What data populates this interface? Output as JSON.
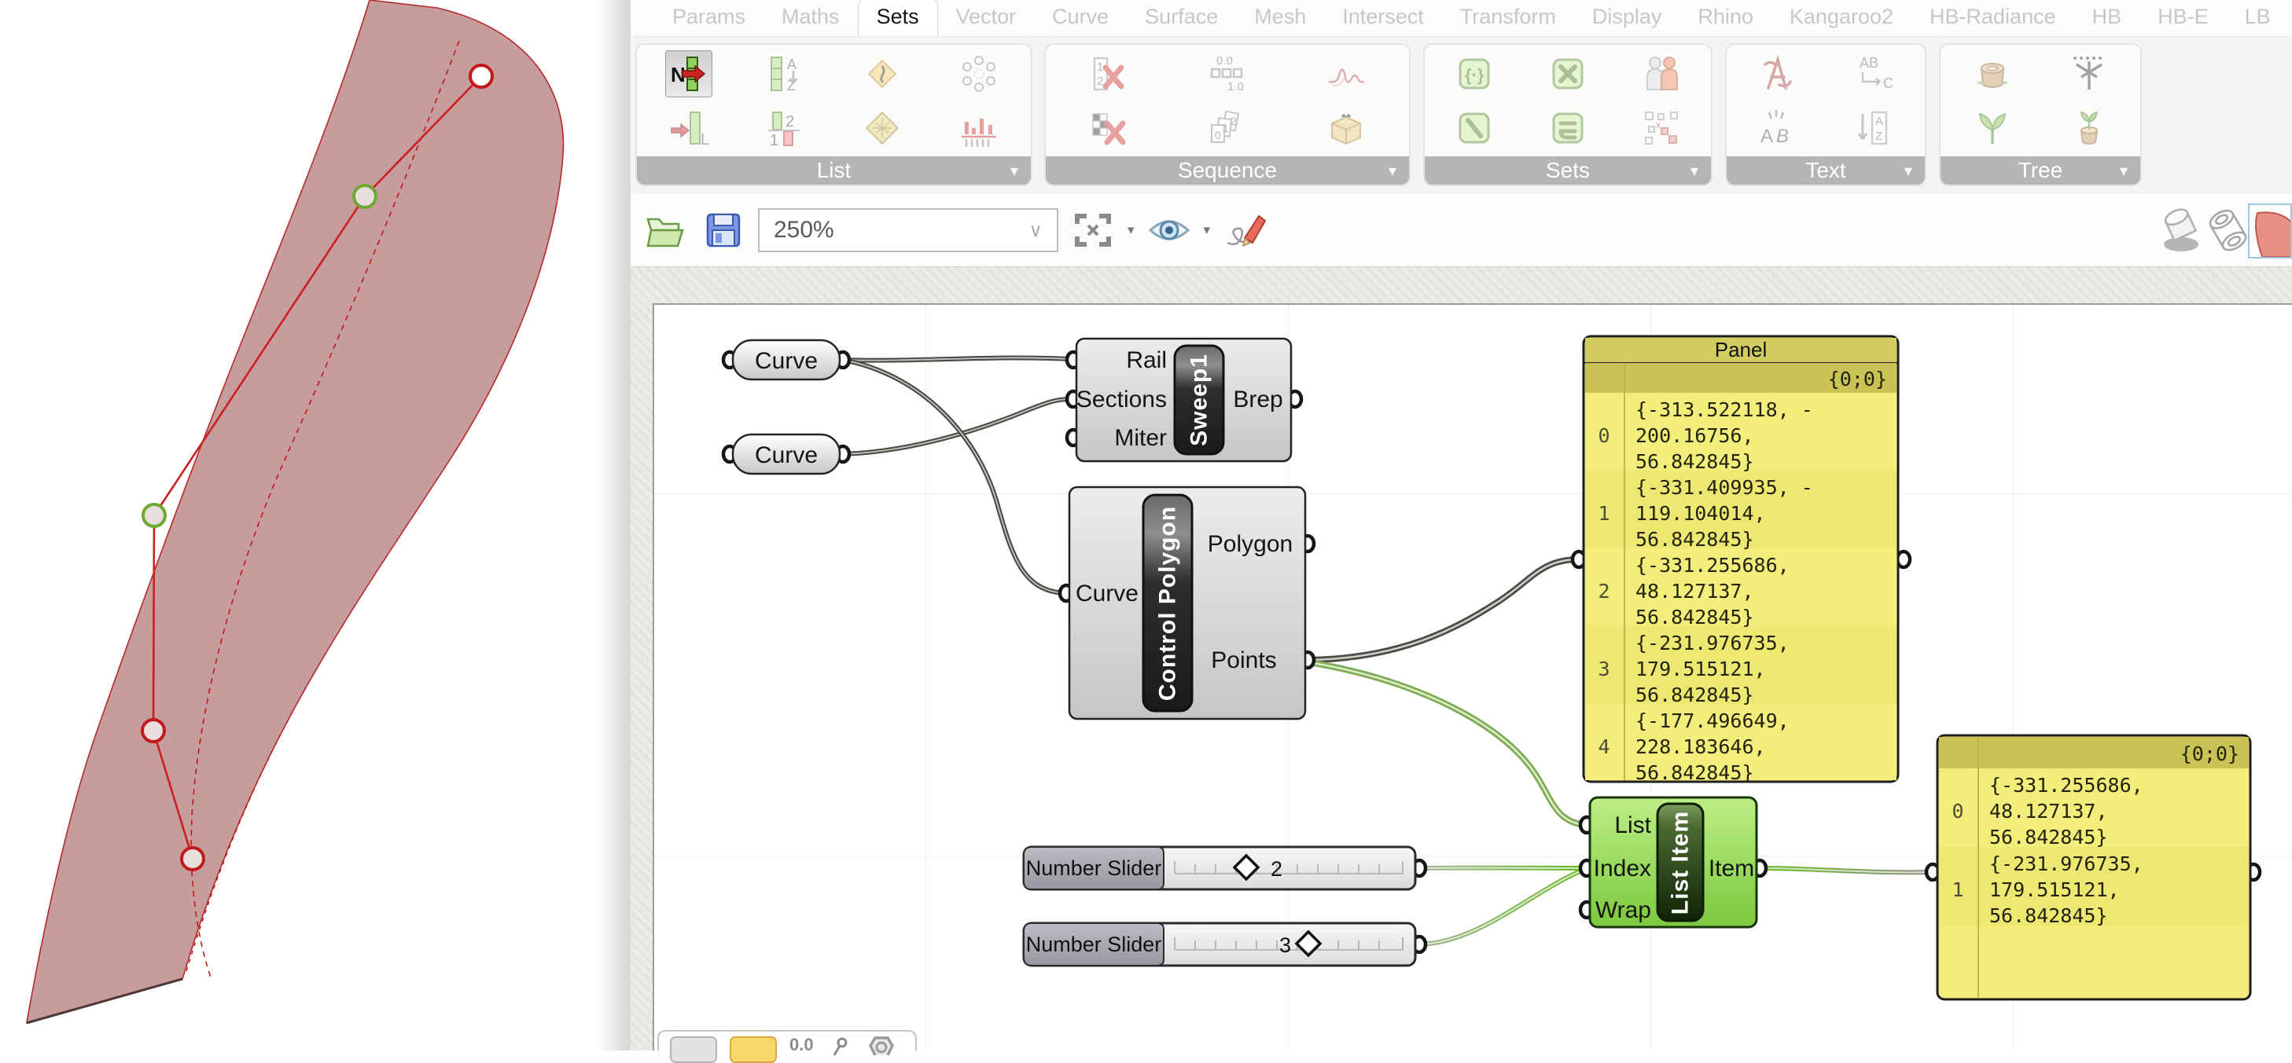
{
  "menu": {
    "tabs": [
      {
        "label": "Params",
        "active": false
      },
      {
        "label": "Maths",
        "active": false
      },
      {
        "label": "Sets",
        "active": true
      },
      {
        "label": "Vector",
        "active": false
      },
      {
        "label": "Curve",
        "active": false
      },
      {
        "label": "Surface",
        "active": false
      },
      {
        "label": "Mesh",
        "active": false
      },
      {
        "label": "Intersect",
        "active": false
      },
      {
        "label": "Transform",
        "active": false
      },
      {
        "label": "Display",
        "active": false
      },
      {
        "label": "Rhino",
        "active": false
      },
      {
        "label": "Kangaroo2",
        "active": false
      },
      {
        "label": "HB-Radiance",
        "active": false
      },
      {
        "label": "HB",
        "active": false
      },
      {
        "label": "HB-E",
        "active": false
      },
      {
        "label": "LB",
        "active": false
      }
    ]
  },
  "ribbon": {
    "groups": [
      {
        "label": "List",
        "icons": [
          "list-item",
          "sort-list",
          "item-index",
          "weave",
          "shift-list",
          "partition-list",
          "sift-pattern",
          "dispatch"
        ]
      },
      {
        "label": "Sequence",
        "icons": [
          "cull-index",
          "range",
          "random",
          "cull-pattern",
          "sequence",
          "cull-box"
        ]
      },
      {
        "label": "Sets",
        "icons": [
          "create-set",
          "set-difference",
          "member-index",
          "set-intersection",
          "set-union",
          "delete-consecutive"
        ]
      },
      {
        "label": "Text",
        "icons": [
          "text-fragment",
          "concatenate",
          "characters",
          "sort-text"
        ]
      },
      {
        "label": "Tree",
        "icons": [
          "tree-stump",
          "explode-tree",
          "flatten-tree",
          "graft-tree"
        ]
      }
    ]
  },
  "canvas_toolbar": {
    "zoom_value": "250%",
    "icons": [
      "open-file",
      "save-file",
      "zoom-extents",
      "preview",
      "sketch",
      "shaded-preview",
      "wireframe-preview",
      "selected-only-preview"
    ]
  },
  "graph": {
    "curve1": {
      "label": "Curve"
    },
    "curve2": {
      "label": "Curve"
    },
    "sweep": {
      "title": "Sweep1",
      "inputs": [
        "Rail",
        "Sections",
        "Miter"
      ],
      "output": "Brep"
    },
    "control_polygon": {
      "title": "Control Polygon",
      "input": "Curve",
      "outputs": [
        "Polygon",
        "Points"
      ]
    },
    "list_item": {
      "title": "List Item",
      "inputs": [
        "List",
        "Index",
        "Wrap"
      ],
      "output": "Item"
    },
    "slider1": {
      "label": "Number Slider",
      "value": "2"
    },
    "slider2": {
      "label": "Number Slider",
      "value": "3"
    },
    "panel_left": {
      "title": "Panel",
      "path": "{0;0}",
      "rows": [
        {
          "index": "0",
          "lines": [
            "{-313.522118, -",
            "200.16756,",
            "56.842845}"
          ]
        },
        {
          "index": "1",
          "lines": [
            "{-331.409935, -",
            "119.104014,",
            "56.842845}"
          ]
        },
        {
          "index": "2",
          "lines": [
            "{-331.255686,",
            "48.127137,",
            "56.842845}"
          ]
        },
        {
          "index": "3",
          "lines": [
            "{-231.976735,",
            "179.515121,",
            "56.842845}"
          ]
        },
        {
          "index": "4",
          "lines": [
            "{-177.496649,",
            "228.183646,",
            "56.842845}"
          ]
        }
      ]
    },
    "panel_right": {
      "path": "{0;0}",
      "rows": [
        {
          "index": "0",
          "lines": [
            "{-331.255686,",
            "48.127137,",
            "56.842845}"
          ]
        },
        {
          "index": "1",
          "lines": [
            "{-231.976735,",
            "179.515121,",
            "56.842845}"
          ]
        }
      ]
    },
    "bottom_widget": {
      "value": "0.0"
    }
  },
  "colors": {
    "selected_green": "#7cc93e",
    "panel_yellow": "#f2ed79",
    "panel_header": "#c9c255",
    "wire_gray": "#4a4a46",
    "surface_rose": "#c69c9d",
    "curve_red": "#c01818"
  }
}
